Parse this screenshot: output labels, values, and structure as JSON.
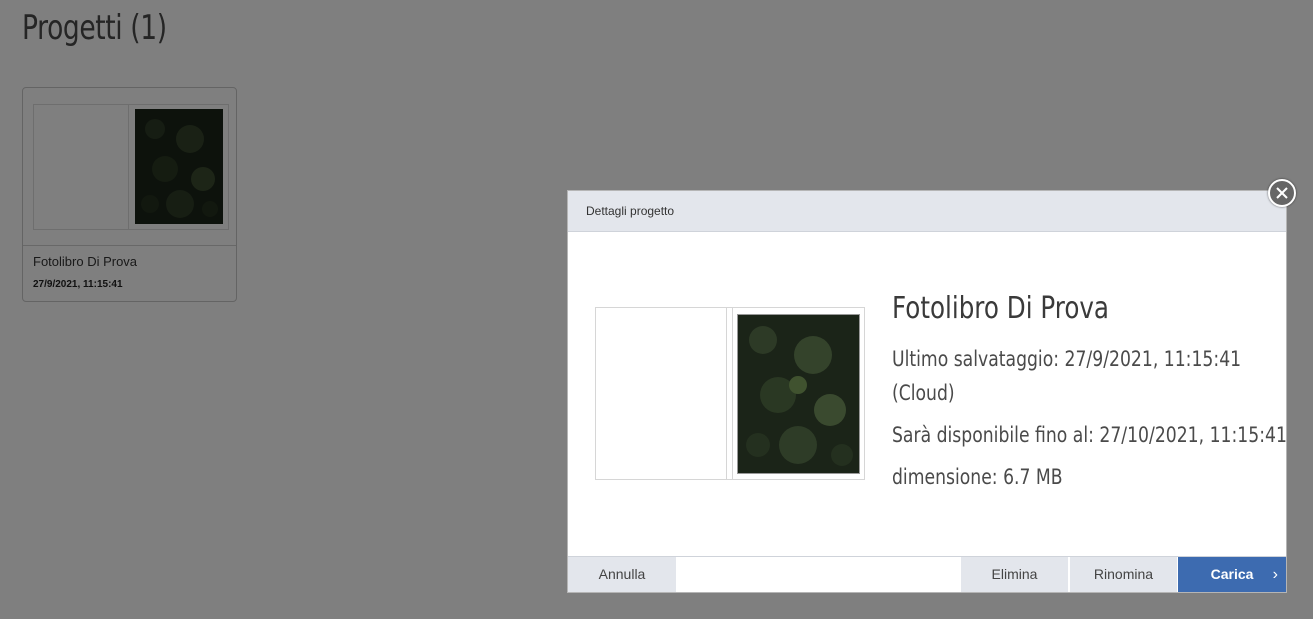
{
  "page": {
    "title": "Progetti (1)"
  },
  "project_card": {
    "name": "Fotolibro Di Prova",
    "date": "27/9/2021, 11:15:41"
  },
  "modal": {
    "header_title": "Dettagli progetto",
    "project_name": "Fotolibro Di Prova",
    "last_saved": "Ultimo salvataggio: 27/9/2021, 11:15:41",
    "storage": "(Cloud)",
    "available_until": "Sarà disponibile fino al: 27/10/2021, 11:15:41",
    "size": "dimensione: 6.7 MB",
    "close_icon": "close-icon",
    "buttons": {
      "cancel": "Annulla",
      "delete": "Elimina",
      "rename": "Rinomina",
      "upload": "Carica",
      "upload_icon": "chevron-right-icon"
    }
  },
  "colors": {
    "overlay": "rgba(0,0,0,0.5)",
    "modal_header": "#e3e6ec",
    "primary_button": "#3d6bb0"
  }
}
